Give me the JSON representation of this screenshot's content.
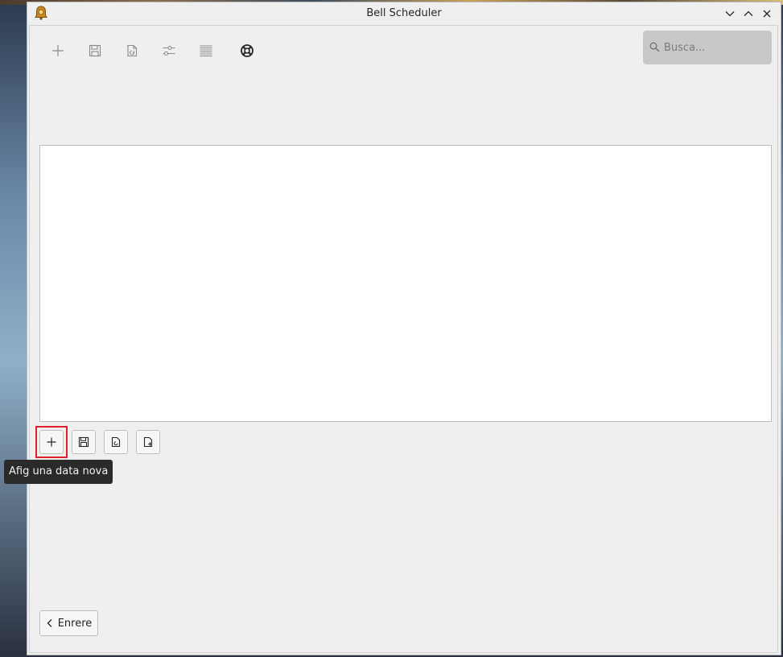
{
  "window": {
    "title": "Bell Scheduler",
    "controls": [
      "minimize",
      "maximize",
      "close"
    ]
  },
  "toolbar": {
    "items": [
      {
        "icon": "plus-icon"
      },
      {
        "icon": "save-icon"
      },
      {
        "icon": "import-icon"
      },
      {
        "icon": "settings-sliders-icon"
      },
      {
        "icon": "list-icon"
      },
      {
        "icon": "help-lifebuoy-icon"
      }
    ]
  },
  "search": {
    "placeholder": "Busca...",
    "value": ""
  },
  "date_actions": {
    "buttons": [
      {
        "icon": "plus-icon"
      },
      {
        "icon": "save-icon"
      },
      {
        "icon": "import-file-icon"
      },
      {
        "icon": "export-file-icon"
      }
    ],
    "tooltip": "Afig una data nova"
  },
  "footer": {
    "back_label": "Enrere"
  },
  "colors": {
    "highlight": "#e0202a",
    "window_bg": "#efefef",
    "tooltip_bg": "#2a2a2a"
  }
}
